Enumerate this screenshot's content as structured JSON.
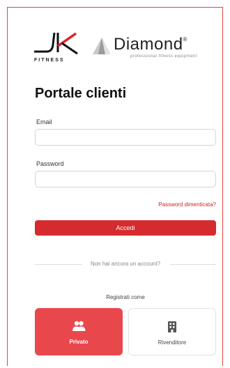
{
  "logos": {
    "jk_name": "JK",
    "jk_sub": "FITNESS",
    "diamond_name": "Diamond",
    "diamond_registered": "®",
    "diamond_tagline": "professional fitness equipment",
    "brand_red": "#d52a2e"
  },
  "page": {
    "title": "Portale clienti"
  },
  "form": {
    "email_label": "Email",
    "email_value": "",
    "password_label": "Password",
    "password_value": "",
    "forgot_link": "Password dimenticata?",
    "submit_label": "Accedi"
  },
  "signup": {
    "no_account_text": "Non hai ancora un account?",
    "register_as": "Registrati come",
    "options": [
      {
        "label": "Privato",
        "icon": "users-icon",
        "selected": true
      },
      {
        "label": "Rivenditore",
        "icon": "building-icon",
        "selected": false
      }
    ]
  }
}
